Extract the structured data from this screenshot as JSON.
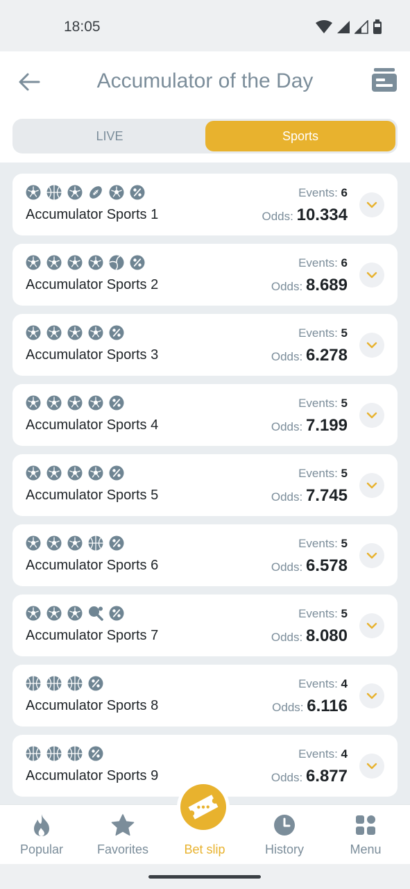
{
  "status_bar": {
    "time": "18:05"
  },
  "header": {
    "title": "Accumulator of the Day"
  },
  "tabs": [
    {
      "label": "LIVE",
      "active": false
    },
    {
      "label": "Sports",
      "active": true
    }
  ],
  "labels": {
    "events": "Events:",
    "odds": "Odds:"
  },
  "colors": {
    "accent": "#e8b22e",
    "muted": "#7b8d9a",
    "icon": "#6f8593",
    "text": "#1d2226"
  },
  "accumulators": [
    {
      "name": "Accumulator Sports 1",
      "events": "6",
      "odds": "10.334",
      "icons": [
        "soccer-icon",
        "basketball-icon",
        "soccer-icon",
        "american-football-icon",
        "soccer-icon",
        "percent-icon"
      ]
    },
    {
      "name": "Accumulator Sports 2",
      "events": "6",
      "odds": "8.689",
      "icons": [
        "soccer-icon",
        "soccer-icon",
        "soccer-icon",
        "soccer-icon",
        "volleyball-icon",
        "percent-icon"
      ]
    },
    {
      "name": "Accumulator Sports 3",
      "events": "5",
      "odds": "6.278",
      "icons": [
        "soccer-icon",
        "soccer-icon",
        "soccer-icon",
        "soccer-icon",
        "percent-icon"
      ]
    },
    {
      "name": "Accumulator Sports 4",
      "events": "5",
      "odds": "7.199",
      "icons": [
        "soccer-icon",
        "soccer-icon",
        "soccer-icon",
        "soccer-icon",
        "percent-icon"
      ]
    },
    {
      "name": "Accumulator Sports 5",
      "events": "5",
      "odds": "7.745",
      "icons": [
        "soccer-icon",
        "soccer-icon",
        "soccer-icon",
        "soccer-icon",
        "percent-icon"
      ]
    },
    {
      "name": "Accumulator Sports 6",
      "events": "5",
      "odds": "6.578",
      "icons": [
        "soccer-icon",
        "soccer-icon",
        "soccer-icon",
        "basketball-icon",
        "percent-icon"
      ]
    },
    {
      "name": "Accumulator Sports 7",
      "events": "5",
      "odds": "8.080",
      "icons": [
        "soccer-icon",
        "soccer-icon",
        "soccer-icon",
        "table-tennis-icon",
        "percent-icon"
      ]
    },
    {
      "name": "Accumulator Sports 8",
      "events": "4",
      "odds": "6.116",
      "icons": [
        "basketball-icon",
        "basketball-icon",
        "basketball-icon",
        "percent-icon"
      ]
    },
    {
      "name": "Accumulator Sports 9",
      "events": "4",
      "odds": "6.877",
      "icons": [
        "basketball-icon",
        "basketball-icon",
        "basketball-icon",
        "percent-icon"
      ]
    }
  ],
  "bottom_nav": [
    {
      "label": "Popular",
      "icon": "flame-icon",
      "active": false
    },
    {
      "label": "Favorites",
      "icon": "star-icon",
      "active": false
    },
    {
      "label": "Bet slip",
      "icon": "ticket-icon",
      "active": true
    },
    {
      "label": "History",
      "icon": "clock-icon",
      "active": false
    },
    {
      "label": "Menu",
      "icon": "grid-icon",
      "active": false
    }
  ]
}
